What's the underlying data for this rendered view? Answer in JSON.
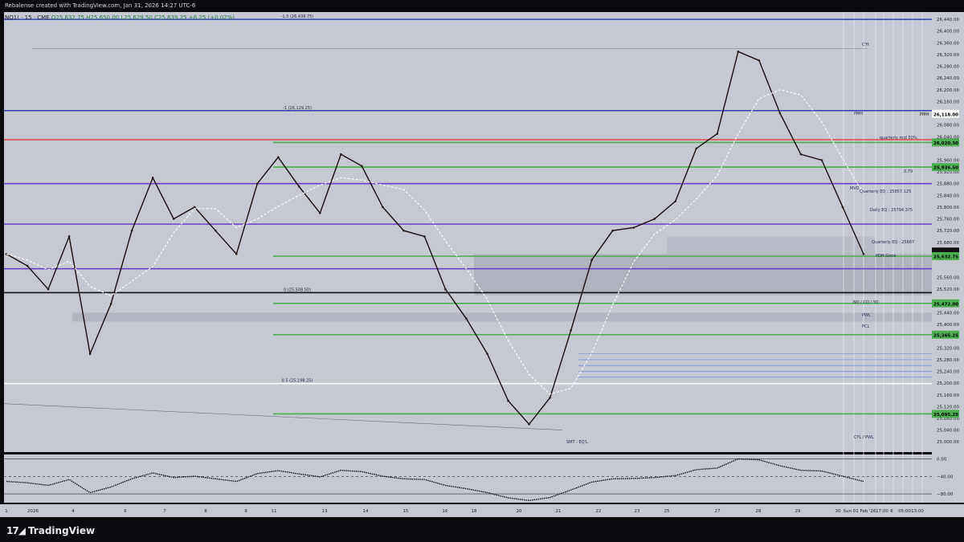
{
  "header": {
    "credit": "Rebalense created with TradingView.com, Jan 31, 2026 14:27 UTC-6"
  },
  "ohlc": {
    "symbol": "NQ1! · 15 · CME",
    "open": "O25,632.75",
    "high": "H25,650.00",
    "low": "L25,629.50",
    "close": "C25,639.25",
    "change": "+6.25 (+0.02%)"
  },
  "brand": {
    "name": "TradingView",
    "logo_icon": "tradingview-logo-icon"
  },
  "chart_data": {
    "type": "line",
    "instrument": "NQ1!",
    "timeframe": "15",
    "ylim": [
      24965,
      26465
    ],
    "y_ticks": [
      "26,440.00",
      "26,400.00",
      "26,360.00",
      "26,320.00",
      "26,280.00",
      "26,240.00",
      "26,200.00",
      "26,160.00",
      "26,080.00",
      "26,040.00",
      "25,960.00",
      "25,920.00",
      "25,880.00",
      "25,840.00",
      "25,800.00",
      "25,760.00",
      "25,720.00",
      "25,680.00",
      "25,560.00",
      "25,520.00",
      "25,440.00",
      "25,400.00",
      "25,320.00",
      "25,280.00",
      "25,240.00",
      "25,200.00",
      "25,160.00",
      "25,120.00",
      "25,080.00",
      "25,040.00",
      "25,000.00"
    ],
    "x_ticks": [
      "1",
      "2026",
      "4",
      "6",
      "7",
      "8",
      "9",
      "11",
      "13",
      "14",
      "15",
      "16",
      "18",
      "20",
      "21",
      "22",
      "23",
      "25",
      "27",
      "28",
      "29",
      "30",
      "Sun 01 Feb '26",
      "17:00",
      "6",
      "05:00",
      "13:00"
    ],
    "price_labels": [
      {
        "text": "26,118.00",
        "value": 26118,
        "color": "#ffffff",
        "text_color": "#000000"
      },
      {
        "text": "26,020.50",
        "value": 26020.5,
        "color": "#4caf50",
        "text_color": "#000000"
      },
      {
        "text": "25,936.50",
        "value": 25936.5,
        "color": "#4caf50",
        "text_color": "#000000"
      },
      {
        "text": "25,648.50",
        "value": 25648.5,
        "color": "#111111",
        "text_color": "#ffffff"
      },
      {
        "text": "25,639.25",
        "value": 25639.25,
        "color": "#111111",
        "text_color": "#ffffff"
      },
      {
        "text": "25,632.75",
        "value": 25632.75,
        "color": "#4caf50",
        "text_color": "#000000"
      },
      {
        "text": "25,472.00",
        "value": 25472,
        "color": "#4caf50",
        "text_color": "#000000"
      },
      {
        "text": "25,365.25",
        "value": 25365.25,
        "color": "#4caf50",
        "text_color": "#000000"
      },
      {
        "text": "25,095.25",
        "value": 25095.25,
        "color": "#4caf50",
        "text_color": "#000000"
      }
    ],
    "horizontal_levels": [
      {
        "value": 26440,
        "color": "#2a3fb0",
        "label": "-1.5 (26,439.75)"
      },
      {
        "value": 26129,
        "color": "#2a3fb0",
        "label": "-1 (26,129.25)"
      },
      {
        "value": 25508.5,
        "color": "#111111",
        "label": "0 (25,508.50)"
      },
      {
        "value": 25198.5,
        "color": "#ffffff",
        "label": "0.5 (25,198.25)"
      },
      {
        "value": 26030,
        "color": "#e05050",
        "label": ""
      },
      {
        "value": 26020.5,
        "color": "#4caf50",
        "label": ""
      },
      {
        "value": 25936.5,
        "color": "#4caf50",
        "label": ""
      },
      {
        "value": 25880,
        "color": "#6a3fd0",
        "label": ""
      },
      {
        "value": 25742,
        "color": "#6a3fd0",
        "label": ""
      },
      {
        "value": 25632.75,
        "color": "#4caf50",
        "label": ""
      },
      {
        "value": 25590,
        "color": "#6a3fd0",
        "label": ""
      },
      {
        "value": 25472,
        "color": "#4caf50",
        "label": ""
      },
      {
        "value": 25365.25,
        "color": "#4caf50",
        "label": ""
      },
      {
        "value": 25095.25,
        "color": "#4caf50",
        "label": ""
      }
    ],
    "annotations": [
      "C'H",
      "PMH",
      "PMH",
      "quarterly mid 50%",
      "MVD",
      "Quarterly EQ : 25857.125",
      "Daily EQ : 25794.375",
      "Quarterly EQ : 25687",
      "PDH Gone",
      "ND / CO / YO",
      "PWL",
      "PCL",
      "CYL / PWL",
      "SMT - EQ'L",
      "0.79"
    ],
    "series": [
      {
        "name": "",
        "color": "#1a0c0c",
        "values": [
          25640,
          25600,
          25520,
          25700,
          25300,
          25470,
          25720,
          25900,
          25760,
          25800,
          25720,
          25640,
          25880,
          25970,
          25870,
          25780,
          25980,
          25940,
          25800,
          25720,
          25700,
          25520,
          25420,
          25300,
          25140,
          25060,
          25150,
          25380,
          25620,
          25720,
          25730,
          25760,
          25820,
          26000,
          26050,
          26330,
          26300,
          26120,
          25980,
          25960,
          25800,
          25640
        ]
      }
    ]
  },
  "oscillator": {
    "ticks": [
      "0.00",
      "−40.00",
      "−80.00"
    ],
    "ylim": [
      -100,
      10
    ]
  }
}
